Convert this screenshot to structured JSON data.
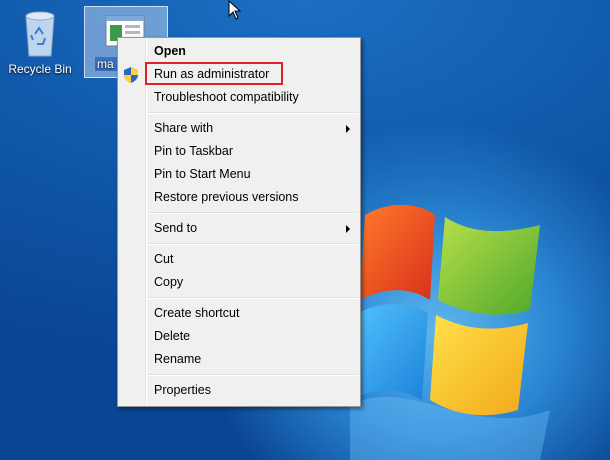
{
  "desktop": {
    "recycle_bin_label": "Recycle Bin",
    "app_icon_label": "ma"
  },
  "context_menu": {
    "items": [
      {
        "label": "Open"
      },
      {
        "label": "Run as administrator"
      },
      {
        "label": "Troubleshoot compatibility"
      },
      {
        "label": "Share with"
      },
      {
        "label": "Pin to Taskbar"
      },
      {
        "label": "Pin to Start Menu"
      },
      {
        "label": "Restore previous versions"
      },
      {
        "label": "Send to"
      },
      {
        "label": "Cut"
      },
      {
        "label": "Copy"
      },
      {
        "label": "Create shortcut"
      },
      {
        "label": "Delete"
      },
      {
        "label": "Rename"
      },
      {
        "label": "Properties"
      }
    ]
  },
  "colors": {
    "highlight_box": "#e0202a",
    "menu_background": "#f0f0f0"
  }
}
